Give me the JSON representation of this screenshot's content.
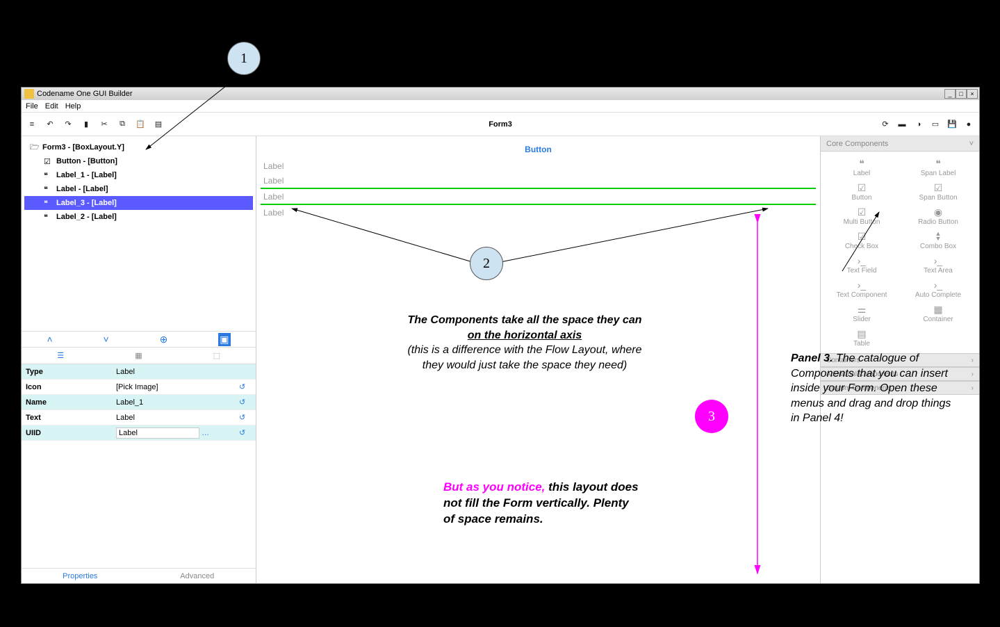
{
  "window": {
    "title": "Codename One GUI Builder"
  },
  "menubar": [
    "File",
    "Edit",
    "Help"
  ],
  "toolbar": {
    "center_title": "Form3"
  },
  "tree": {
    "root": "Form3 - [BoxLayout.Y]",
    "items": [
      {
        "label": "Button - [Button]"
      },
      {
        "label": "Label_1 - [Label]"
      },
      {
        "label": "Label - [Label]"
      },
      {
        "label": "Label_3 - [Label]",
        "selected": true
      },
      {
        "label": "Label_2 - [Label]"
      }
    ]
  },
  "props": {
    "rows": [
      {
        "k": "Type",
        "v": "Label"
      },
      {
        "k": "Icon",
        "v": "[Pick Image]"
      },
      {
        "k": "Name",
        "v": "Label_1"
      },
      {
        "k": "Text",
        "v": "Label"
      },
      {
        "k": "UIID",
        "v": "Label",
        "input": true
      }
    ],
    "bottom_tabs": [
      "Properties",
      "Advanced"
    ],
    "active_bottom": "Properties"
  },
  "canvas": {
    "button": "Button",
    "labels": [
      "Label",
      "Label",
      "Label",
      "Label"
    ]
  },
  "palette": {
    "header": "Core Components",
    "items": [
      {
        "label": "Label",
        "glyph": "❝"
      },
      {
        "label": "Span Label",
        "glyph": "❝"
      },
      {
        "label": "Button",
        "glyph": "☑"
      },
      {
        "label": "Span Button",
        "glyph": "☑"
      },
      {
        "label": "Multi Button",
        "glyph": "☑"
      },
      {
        "label": "Radio Button",
        "glyph": "◉"
      },
      {
        "label": "Check Box",
        "glyph": "☑"
      },
      {
        "label": "Combo Box",
        "glyph": "▲▼"
      },
      {
        "label": "Text Field",
        "glyph": "›_"
      },
      {
        "label": "Text Area",
        "glyph": "›_"
      },
      {
        "label": "Text Component",
        "glyph": "›_"
      },
      {
        "label": "Auto Complete",
        "glyph": "›_"
      },
      {
        "label": "Slider",
        "glyph": "⚌"
      },
      {
        "label": "Container",
        "glyph": "▦"
      },
      {
        "label": "Table",
        "glyph": "▤"
      },
      {
        "label": "",
        "glyph": ""
      }
    ],
    "sections": [
      "Containers",
      "Additional Components",
      "Custom Components"
    ]
  },
  "annotations": {
    "c1": "1",
    "c2": "2",
    "c3": "3",
    "t2_l1": "The Components take all the space they can",
    "t2_l2": "on the horizontal axis",
    "t2_l3": "(this is a difference with the Flow Layout, where",
    "t2_l4": "they would just take the space they need)",
    "t3_l0": "But as you notice,",
    "t3_l1": " this layout does",
    "t3_l2": "not fill the Form vertically. Plenty",
    "t3_l3": "of space remains.",
    "panel3_lead": "Panel 3.",
    "panel3_rest": " The catalogue of Components that you can insert inside your Form. Open these menus and drag and drop things in Panel 4!"
  }
}
